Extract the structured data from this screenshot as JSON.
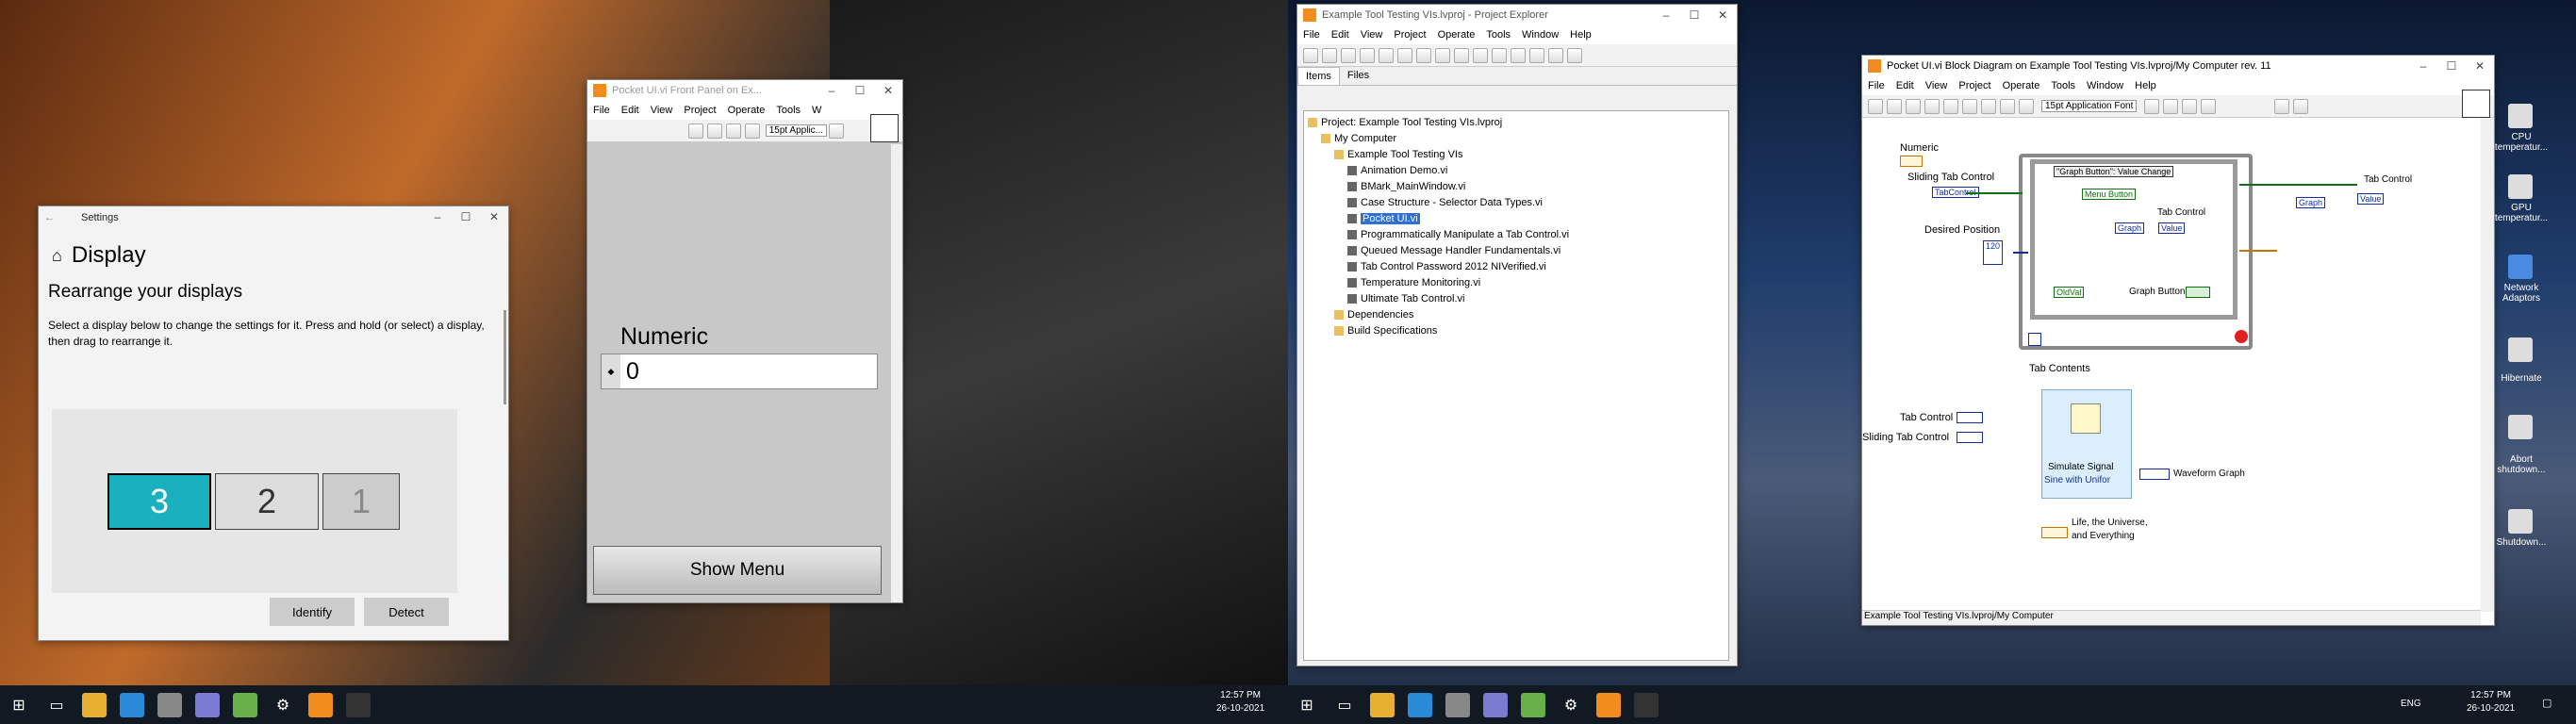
{
  "settings": {
    "title": "Settings",
    "heading": "Display",
    "subheading": "Rearrange your displays",
    "description": "Select a display below to change the settings for it. Press and hold (or select) a display, then drag to rearrange it.",
    "displays": [
      "3",
      "2",
      "1"
    ],
    "identify_label": "Identify",
    "detect_label": "Detect"
  },
  "frontpanel": {
    "title": "Pocket UI.vi Front Panel on Ex...",
    "menu": [
      "File",
      "Edit",
      "View",
      "Project",
      "Operate",
      "Tools",
      "W"
    ],
    "font": "15pt Applic...",
    "numeric_label": "Numeric",
    "numeric_value": "0",
    "show_menu_label": "Show Menu"
  },
  "explorer": {
    "title": "Example Tool Testing VIs.lvproj - Project Explorer",
    "menu": [
      "File",
      "Edit",
      "View",
      "Project",
      "Operate",
      "Tools",
      "Window",
      "Help"
    ],
    "tabs": [
      "Items",
      "Files"
    ],
    "tree": [
      {
        "label": "Project: Example Tool Testing VIs.lvproj",
        "indent": 0
      },
      {
        "label": "My Computer",
        "indent": 1
      },
      {
        "label": "Example Tool Testing VIs",
        "indent": 2
      },
      {
        "label": "Animation Demo.vi",
        "indent": 3
      },
      {
        "label": "BMark_MainWindow.vi",
        "indent": 3
      },
      {
        "label": "Case Structure - Selector Data Types.vi",
        "indent": 3
      },
      {
        "label": "Pocket UI.vi",
        "indent": 3,
        "selected": true
      },
      {
        "label": "Programmatically Manipulate a Tab Control.vi",
        "indent": 3
      },
      {
        "label": "Queued Message Handler Fundamentals.vi",
        "indent": 3
      },
      {
        "label": "Tab Control Password 2012 NIVerified.vi",
        "indent": 3
      },
      {
        "label": "Temperature Monitoring.vi",
        "indent": 3
      },
      {
        "label": "Ultimate Tab Control.vi",
        "indent": 3
      },
      {
        "label": "Dependencies",
        "indent": 2
      },
      {
        "label": "Build Specifications",
        "indent": 2
      }
    ]
  },
  "blockdiagram": {
    "title": "Pocket UI.vi Block Diagram on Example Tool Testing VIs.lvproj/My Computer rev. 11",
    "menu": [
      "File",
      "Edit",
      "View",
      "Project",
      "Operate",
      "Tools",
      "Window",
      "Help"
    ],
    "font": "15pt Application Font",
    "labels": {
      "numeric": "Numeric",
      "sliding_tab_control": "Sliding Tab Control",
      "tab_control_term": "TabControl",
      "desired_position": "Desired Position",
      "desired_value": "120",
      "case_selector": "\"Graph Button\": Value Change",
      "menu_button": "Menu Button",
      "tab_control": "Tab Control",
      "graph": "Graph",
      "value": "Value",
      "old_val": "OldVal",
      "graph_button": "Graph Button",
      "tab_control_out": "Tab Control",
      "graph_out": "Graph",
      "value_out": "Value",
      "tab_contents": "Tab Contents",
      "tab_control2": "Tab Control",
      "sliding_tab_control2": "Sliding Tab Control",
      "simulate_signal": "Simulate Signal",
      "sine_with": "Sine with Unifor",
      "waveform_graph": "Waveform Graph",
      "life_universe": "Life, the Universe,",
      "and_everything": "and Everything"
    },
    "status": "Example Tool Testing VIs.lvproj/My Computer"
  },
  "desktop_icons": [
    "CPU temperatur...",
    "GPU temperatur...",
    "Network Adaptors",
    "Hibernate",
    "Abort shutdown...",
    "Shutdown..."
  ],
  "taskbar": {
    "time": "12:57 PM",
    "date": "26-10-2021",
    "lang": "ENG"
  }
}
